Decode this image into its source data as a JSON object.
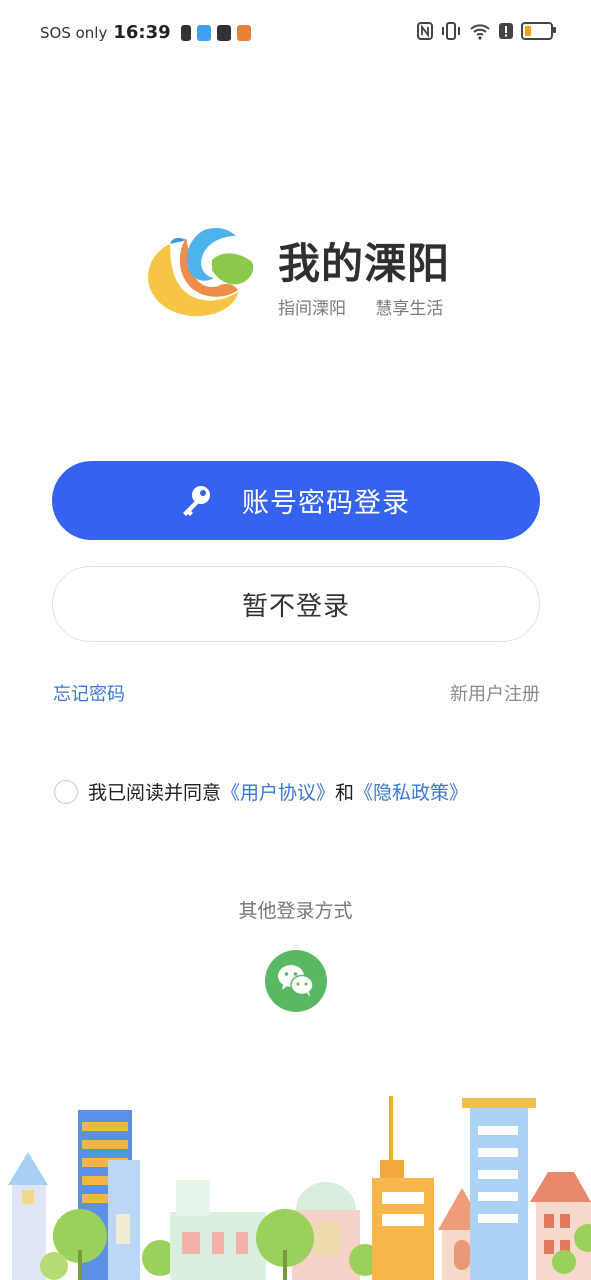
{
  "status_bar": {
    "carrier": "SOS only",
    "time": "16:39",
    "battery_level": 0.25
  },
  "app": {
    "title": "我的溧阳",
    "slogan_1": "指间溧阳",
    "slogan_2": "慧享生活"
  },
  "buttons": {
    "account_login": "账号密码登录",
    "skip_login": "暂不登录"
  },
  "links": {
    "forgot_password": "忘记密码",
    "new_user_register": "新用户注册"
  },
  "agreement": {
    "prefix": "我已阅读并同意",
    "user_agreement": "《用户协议》",
    "and": "和",
    "privacy_policy": "《隐私政策》"
  },
  "other_login": {
    "label": "其他登录方式"
  },
  "colors": {
    "primary": "#3563f0",
    "link": "#3a78d6",
    "wechat": "#5ab764"
  }
}
